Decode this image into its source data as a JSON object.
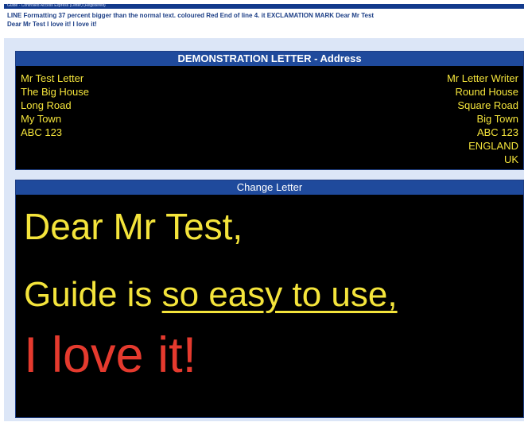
{
  "window": {
    "title": "Guide - Controlled Access Express (Letter) (Registered)"
  },
  "info": {
    "line1": "LINE Formatting 37 percent bigger than the normal text.  coloured Red End of line 4. it EXCLAMATION MARK Dear Mr Test",
    "line2": "Dear Mr Test I love it! I love it!"
  },
  "address_panel": {
    "header": "DEMONSTRATION LETTER - Address",
    "recipient": [
      "Mr Test Letter",
      "The Big House",
      "Long Road",
      "My Town",
      "ABC 123"
    ],
    "sender": [
      "Mr Letter Writer",
      "Round House",
      "Square Road",
      "Big Town",
      "ABC 123",
      "ENGLAND",
      "UK"
    ]
  },
  "letter_panel": {
    "header": "Change Letter",
    "greeting": "Dear Mr Test,",
    "line2_plain": "Guide is ",
    "line2_underlined": "so easy to use,",
    "line3": "I love it!"
  },
  "colors": {
    "header_blue": "#1f4a9c",
    "text_yellow": "#f4e43b",
    "text_red": "#e53a2e",
    "background": "#000000"
  }
}
